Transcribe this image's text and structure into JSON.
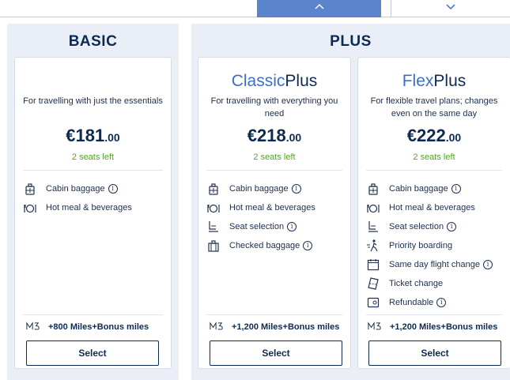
{
  "nav": {
    "collapse_icon": "chevron-up-icon",
    "expand_icon": "chevron-down-icon",
    "accent_color": "#5a85cd"
  },
  "panels": {
    "basic": {
      "title": "BASIC"
    },
    "plus": {
      "title": "PLUS"
    }
  },
  "fares": [
    {
      "name_prefix": "",
      "name_accent": "",
      "description": "For travelling with just the essentials",
      "currency": "€",
      "price_int": "181",
      "price_cents": ".00",
      "seats_left": "2 seats left",
      "features": [
        {
          "icon": "cabin-baggage-icon",
          "label": "Cabin baggage",
          "info": true
        },
        {
          "icon": "hot-meal-icon",
          "label": "Hot meal & beverages",
          "info": false
        }
      ],
      "miles_icon": "miles-and-more-icon",
      "miles": "+800 Miles+Bonus miles",
      "select_label": "Select"
    },
    {
      "name_prefix": "Plus",
      "name_accent": "Classic",
      "description": "For travelling with everything you need",
      "currency": "€",
      "price_int": "218",
      "price_cents": ".00",
      "seats_left": "2 seats left",
      "features": [
        {
          "icon": "cabin-baggage-icon",
          "label": "Cabin baggage",
          "info": true
        },
        {
          "icon": "hot-meal-icon",
          "label": "Hot meal & beverages",
          "info": false
        },
        {
          "icon": "seat-selection-icon",
          "label": "Seat selection",
          "info": true
        },
        {
          "icon": "checked-baggage-icon",
          "label": "Checked baggage",
          "info": true
        }
      ],
      "miles_icon": "miles-and-more-icon",
      "miles": "+1,200 Miles+Bonus miles",
      "select_label": "Select"
    },
    {
      "name_prefix": "Plus",
      "name_accent": "Flex",
      "description": "For flexible travel plans; changes even on the same day",
      "currency": "€",
      "price_int": "222",
      "price_cents": ".00",
      "seats_left": "2 seats left",
      "features": [
        {
          "icon": "cabin-baggage-icon",
          "label": "Cabin baggage",
          "info": true
        },
        {
          "icon": "hot-meal-icon",
          "label": "Hot meal & beverages",
          "info": false
        },
        {
          "icon": "seat-selection-icon",
          "label": "Seat selection",
          "info": true
        },
        {
          "icon": "priority-boarding-icon",
          "label": "Priority boarding",
          "info": false
        },
        {
          "icon": "calendar-change-icon",
          "label": "Same day flight change",
          "info": true
        },
        {
          "icon": "ticket-change-icon",
          "label": "Ticket change",
          "info": false
        },
        {
          "icon": "refund-icon",
          "label": "Refundable",
          "info": true
        }
      ],
      "miles_icon": "miles-and-more-icon",
      "miles": "+1,200 Miles+Bonus miles",
      "select_label": "Select"
    }
  ],
  "colors": {
    "navy": "#0d2a52",
    "accent_blue": "#3d6ec6",
    "seats_green": "#55a12a",
    "panel_bg": "#eaeff7"
  }
}
